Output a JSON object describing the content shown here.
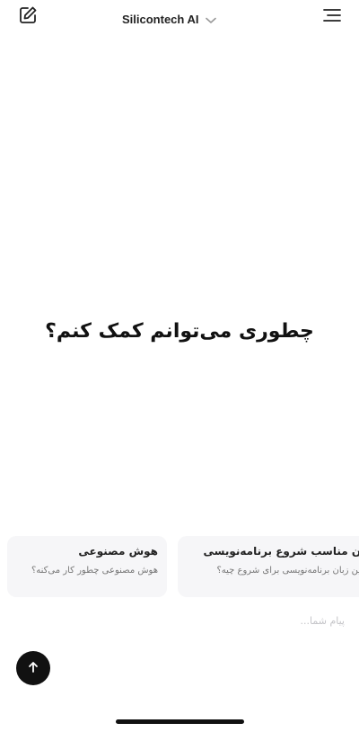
{
  "header": {
    "model_name": "Silicontech AI",
    "icons": {
      "new_chat": "edit-icon",
      "model_dropdown": "chevron-down-icon",
      "menu": "menu-icon"
    }
  },
  "main": {
    "greeting": "چطوری می‌توانم کمک کنم؟"
  },
  "suggestions": [
    {
      "title": "هوش مصنوعی",
      "subtitle": "هوش مصنوعی چطور کار می‌کنه؟"
    },
    {
      "title": "زبان مناسب شروع برنامه‌نویسی",
      "subtitle": "بهترین زبان برنامه‌نویسی برای شروع چیه؟"
    }
  ],
  "composer": {
    "placeholder": "پیام شما...",
    "send_icon": "arrow-up-icon"
  },
  "colors": {
    "background": "#ffffff",
    "card_background": "#f6f6f8",
    "send_button": "#111111",
    "text_primary": "#111111",
    "text_secondary": "#777777"
  }
}
